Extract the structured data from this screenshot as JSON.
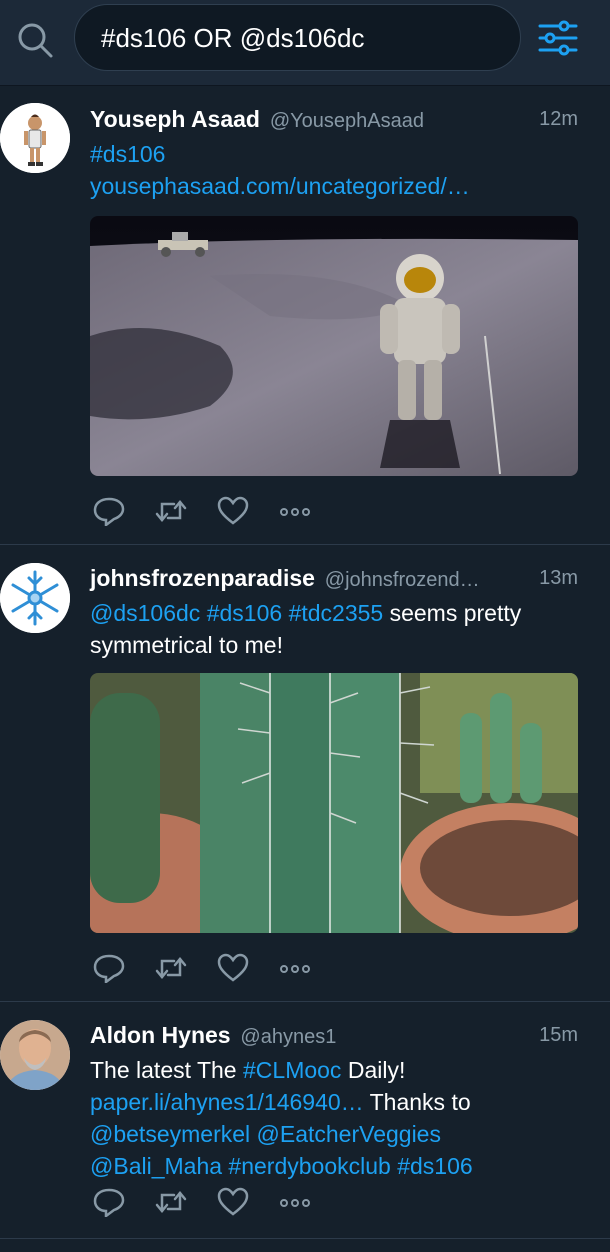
{
  "search": {
    "query": "#ds106 OR @ds106dc"
  },
  "tweets": [
    {
      "name": "Youseph Asaad",
      "handle": "@YousephAsaad",
      "time": "12m",
      "body": [
        {
          "text": "#ds106",
          "link": true
        },
        {
          "text": "yousephasaad.com/uncategorized/…",
          "link": true,
          "block": true
        }
      ],
      "media": "astronaut-on-moon-photo"
    },
    {
      "name": "johnsfrozenparadise",
      "handle": "@johnsfrozend…",
      "time": "13m",
      "body": [
        {
          "text": "@ds106dc",
          "link": true
        },
        {
          "text": " ",
          "link": false
        },
        {
          "text": "#ds106",
          "link": true
        },
        {
          "text": " ",
          "link": false
        },
        {
          "text": "#tdc2355",
          "link": true
        },
        {
          "text": " seems pretty symmetrical to me!",
          "link": false
        }
      ],
      "media": "cactus-photo"
    },
    {
      "name": "Aldon Hynes",
      "handle": "@ahynes1",
      "time": "15m",
      "body": [
        {
          "text": "The latest The ",
          "link": false
        },
        {
          "text": "#CLMooc",
          "link": true
        },
        {
          "text": " Daily! ",
          "link": false
        },
        {
          "text": "paper.li/ahynes1/146940…",
          "link": true
        },
        {
          "text": " Thanks to ",
          "link": false
        },
        {
          "text": "@betseymerkel",
          "link": true
        },
        {
          "text": " ",
          "link": false
        },
        {
          "text": "@EatcherVeggies",
          "link": true
        },
        {
          "text": " ",
          "link": false
        },
        {
          "text": "@Bali_Maha",
          "link": true
        },
        {
          "text": " ",
          "link": false
        },
        {
          "text": "#nerdybookclub",
          "link": true
        },
        {
          "text": " ",
          "link": false
        },
        {
          "text": "#ds106",
          "link": true
        }
      ]
    }
  ],
  "colors": {
    "background": "#15202b",
    "link": "#1da1f2",
    "muted": "#8899a6",
    "accent": "#1da1f2"
  },
  "icons": [
    "search-icon",
    "filter-icon",
    "reply-icon",
    "retweet-icon",
    "like-icon",
    "more-icon"
  ]
}
